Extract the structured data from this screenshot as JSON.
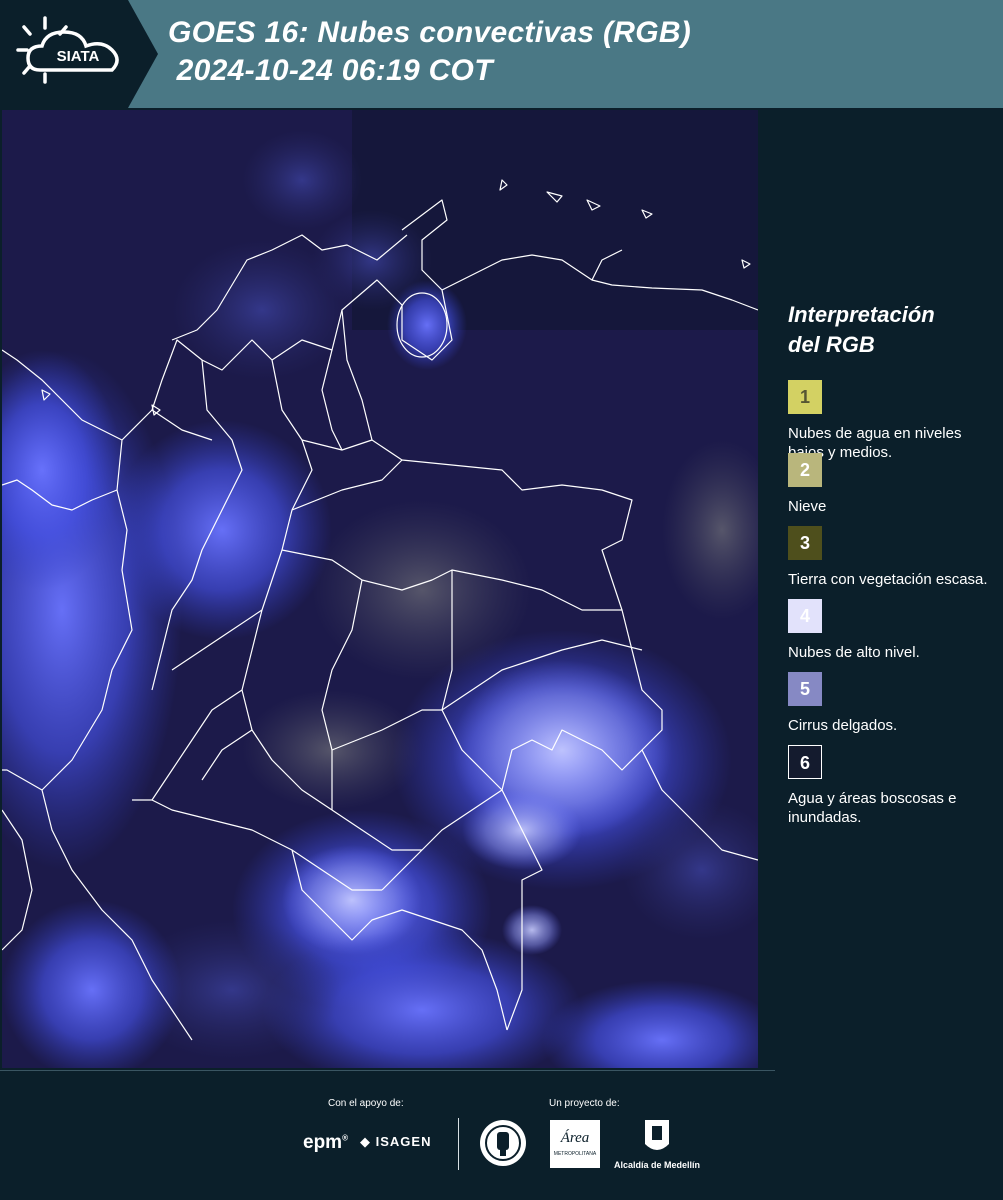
{
  "header": {
    "logo_text": "SIATA",
    "title_line1": "GOES 16: Nubes convectivas (RGB)",
    "title_line2": " 2024-10-24 06:19 COT"
  },
  "legend": {
    "title": "Interpretación\ndel RGB",
    "items": [
      {
        "num": "1",
        "label": "Nubes de agua en niveles bajos y medios.",
        "color": "#d3d163",
        "num_color": "#555533"
      },
      {
        "num": "2",
        "label": "Nieve",
        "color": "#b9b67c",
        "num_color": "#ffffff"
      },
      {
        "num": "3",
        "label": "Tierra con vegetación escasa.",
        "color": "#4e4f1c",
        "num_color": "#ffffff"
      },
      {
        "num": "4",
        "label": "Nubes de alto nivel.",
        "color": "#e2e2fb",
        "num_color": "#ffffff"
      },
      {
        "num": "5",
        "label": "Cirrus delgados.",
        "color": "#8689c4",
        "num_color": "#ffffff"
      },
      {
        "num": "6",
        "label": "Agua y áreas boscosas e inundadas.",
        "color": "#141b2e",
        "num_color": "#ffffff"
      }
    ]
  },
  "footer": {
    "support_label": "Con el apoyo de:",
    "project_label": "Un proyecto de:",
    "epm": "epm",
    "isagen": "ISAGEN",
    "area_logo": "Área",
    "area_sub": "METROPOLITANA",
    "alcaldia": "Alcaldía de Medellín"
  },
  "colors": {
    "header_bg": "#4a7885",
    "page_bg": "#0b1f2a",
    "map_base": "#1c1a4a",
    "cloud_blue": "#4a56f0",
    "border_white": "#ffffff"
  }
}
